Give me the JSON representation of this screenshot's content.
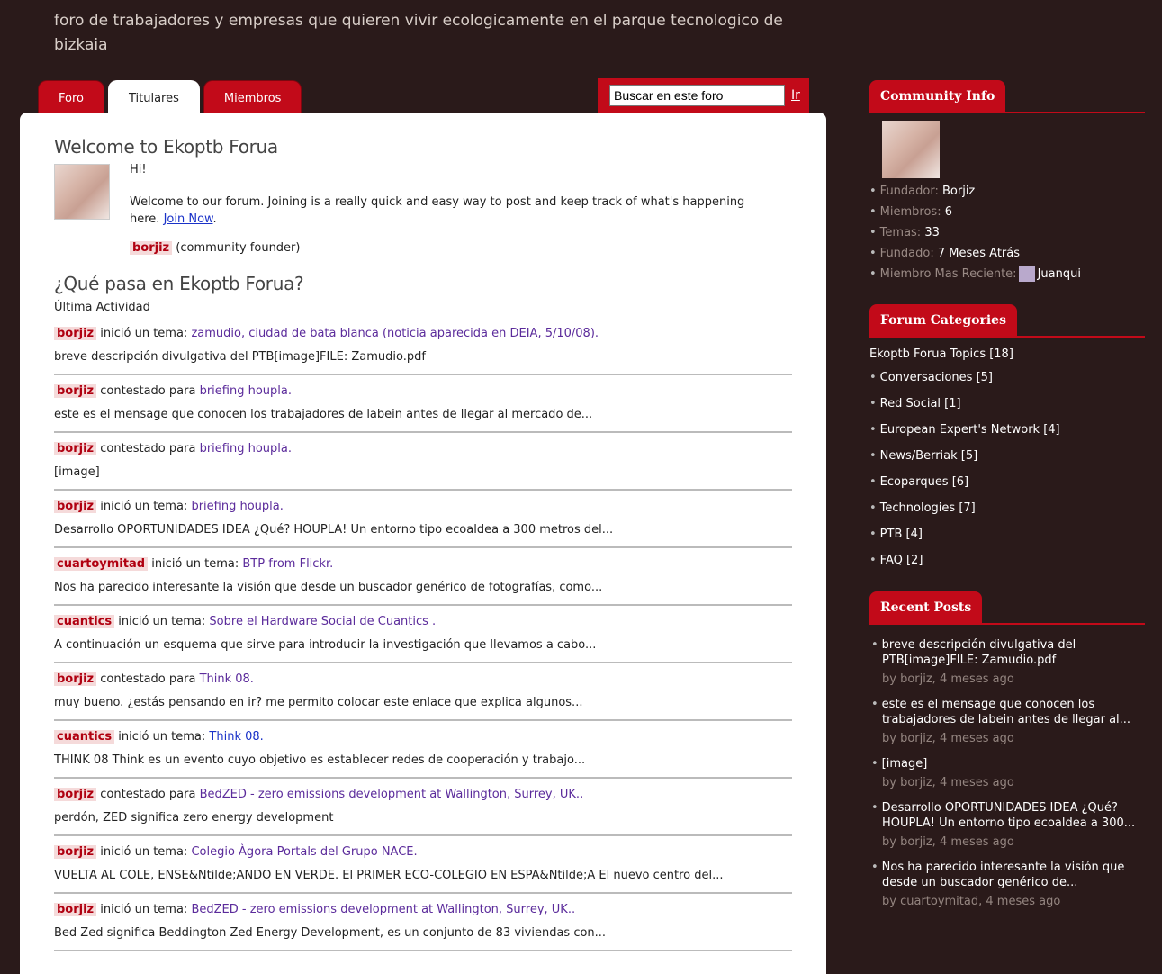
{
  "header": {
    "description": "foro de trabajadores y empresas que quieren vivir ecologicamente en el parque tecnologico de bizkaia"
  },
  "tabs": [
    {
      "label": "Foro",
      "active": false
    },
    {
      "label": "Titulares",
      "active": true
    },
    {
      "label": "Miembros",
      "active": false
    }
  ],
  "search": {
    "value": "Buscar en este foro",
    "go_label": "Ir"
  },
  "main": {
    "welcome_title": "Welcome to Ekoptb Forua",
    "hi": "Hi!",
    "welcome_text": "Welcome to our forum. Joining is a really quick and easy way to post and keep track of what's happening here.",
    "join_link": "Join Now",
    "founder_name": "borjiz",
    "founder_note": "(community founder)",
    "whats_up_title": "¿Qué pasa en Ekoptb Forua?",
    "last_activity_label": "Última Actividad",
    "activities": [
      {
        "user": "borjiz",
        "action": "inició un tema:",
        "topic": "zamudio, ciudad de bata blanca (noticia aparecida en DEIA, 5/10/08).",
        "excerpt": "breve descripción divulgativa del PTB[image]FILE: Zamudio.pdf"
      },
      {
        "user": "borjiz",
        "action": "contestado para",
        "topic": "briefing houpla.",
        "excerpt": "este es el mensage que conocen los trabajadores de labein antes de llegar al mercado de..."
      },
      {
        "user": "borjiz",
        "action": "contestado para",
        "topic": "briefing houpla.",
        "excerpt": "[image]"
      },
      {
        "user": "borjiz",
        "action": "inició un tema:",
        "topic": "briefing houpla.",
        "excerpt": "Desarrollo OPORTUNIDADES IDEA ¿Qué? HOUPLA! Un entorno tipo ecoaldea a 300 metros del..."
      },
      {
        "user": "cuartoymitad",
        "action": "inició un tema:",
        "topic": "BTP from Flickr.",
        "excerpt": "Nos ha parecido interesante la visión que desde un buscador genérico de fotografías, como..."
      },
      {
        "user": "cuantics",
        "action": "inició un tema:",
        "topic": "Sobre el Hardware Social de Cuantics .",
        "excerpt": "A continuación un esquema que sirve para introducir la investigación que llevamos a cabo..."
      },
      {
        "user": "borjiz",
        "action": "contestado para",
        "topic": "Think 08.",
        "excerpt": "muy bueno. ¿estás pensando en ir? me permito colocar este enlace que explica algunos..."
      },
      {
        "user": "cuantics",
        "action": "inició un tema:",
        "topic": "Think 08.",
        "excerpt": "THINK 08 Think es un evento cuyo objetivo es establecer redes de cooperación y trabajo..."
      },
      {
        "user": "borjiz",
        "action": "contestado para",
        "topic": "BedZED - zero emissions development at Wallington, Surrey, UK..",
        "excerpt": "perdón, ZED significa zero energy development"
      },
      {
        "user": "borjiz",
        "action": "inició un tema:",
        "topic": "Colegio Àgora Portals del Grupo NACE.",
        "excerpt": "VUELTA AL COLE, ENSE&Ntilde;ANDO EN VERDE. El PRIMER ECO-COLEGIO EN ESPA&Ntilde;A El nuevo centro del..."
      },
      {
        "user": "borjiz",
        "action": "inició un tema:",
        "topic": "BedZED - zero emissions development at Wallington, Surrey, UK..",
        "excerpt": "Bed Zed significa Beddington Zed Energy Development, es un conjunto de 83 viviendas con..."
      }
    ]
  },
  "sidebar": {
    "community_info": {
      "title": "Community Info",
      "items": [
        {
          "key": "Fundador:",
          "value": "Borjiz"
        },
        {
          "key": "Miembros:",
          "value": "6"
        },
        {
          "key": "Temas:",
          "value": "33"
        },
        {
          "key": "Fundado:",
          "value": "7 Meses Atrás"
        },
        {
          "key": "Miembro Mas Reciente:",
          "value": "Juanqui"
        }
      ]
    },
    "forum_categories": {
      "title": "Forum Categories",
      "root": "Ekoptb Forua Topics [18]",
      "items": [
        "Conversaciones [5]",
        "Red Social [1]",
        "European Expert's Network [4]",
        "News/Berriak [5]",
        "Ecoparques [6]",
        "Technologies [7]",
        "PTB [4]",
        "FAQ [2]"
      ]
    },
    "recent_posts": {
      "title": "Recent Posts",
      "items": [
        {
          "text": "breve descripción divulgativa del PTB[image]FILE: Zamudio.pdf",
          "by": "by borjiz, 4 meses ago"
        },
        {
          "text": "este es el mensage que conocen los trabajadores de labein antes de llegar al...",
          "by": "by borjiz, 4 meses ago"
        },
        {
          "text": "[image]",
          "by": "by borjiz, 4 meses ago"
        },
        {
          "text": "Desarrollo OPORTUNIDADES IDEA ¿Qué? HOUPLA! Un entorno tipo ecoaldea a 300...",
          "by": "by borjiz, 4 meses ago"
        },
        {
          "text": "Nos ha parecido interesante la visión que desde un buscador genérico de...",
          "by": "by cuartoymitad, 4 meses ago"
        }
      ]
    }
  },
  "colors": {
    "accent": "#c20a19",
    "background": "#2a1a1a",
    "link": "#5b2b9b"
  }
}
